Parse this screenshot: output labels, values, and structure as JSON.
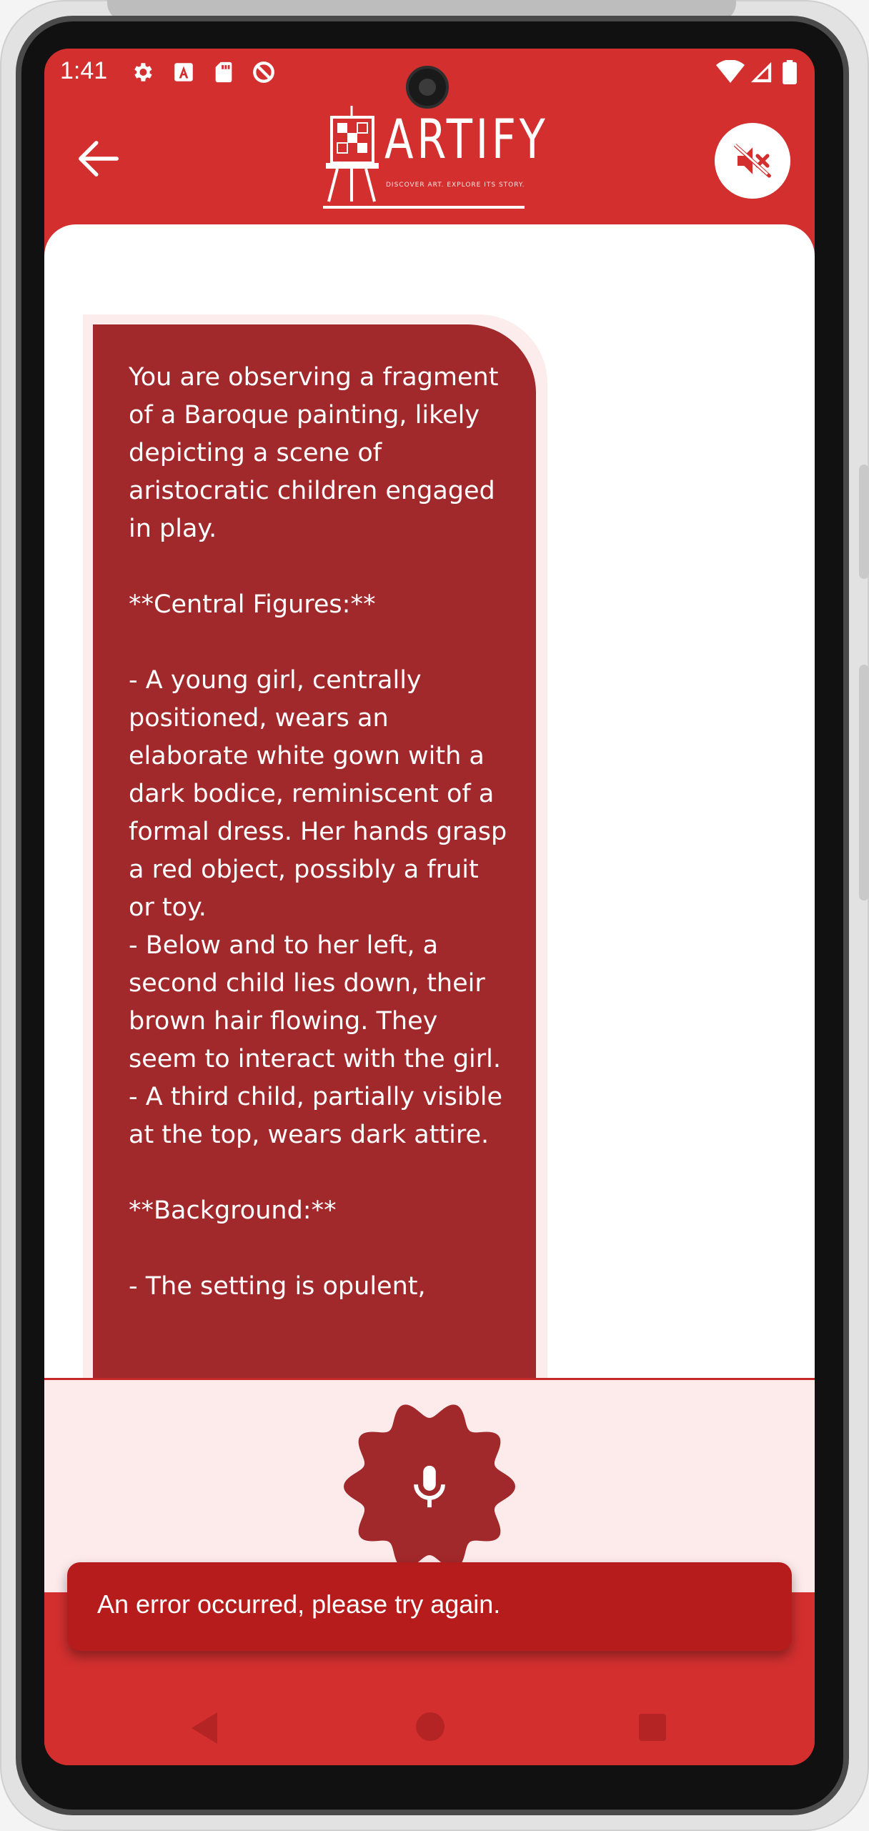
{
  "status_bar": {
    "time": "1:41",
    "icons": [
      "settings-icon",
      "text-a-icon",
      "sd-card-icon",
      "do-not-disturb-icon",
      "wifi-icon",
      "signal-icon",
      "battery-icon"
    ]
  },
  "app_bar": {
    "back_icon": "arrow-back-icon",
    "logo": {
      "name": "ARTIFY",
      "tagline": "DISCOVER ART. EXPLORE ITS STORY."
    },
    "mute_icon": "volume-off-icon"
  },
  "message": {
    "text": "You are observing a fragment of a Baroque painting, likely depicting a scene of aristocratic children engaged in play.\n\n**Central Figures:**\n\n- A young girl, centrally positioned, wears an elaborate white gown with a dark bodice, reminiscent of a formal dress. Her hands grasp a red object, possibly a fruit or toy.\n- Below and to her left, a second child lies down, their brown hair flowing. They seem to interact with the girl.\n- A third child, partially visible at the top, wears dark attire.\n\n**Background:**\n\n- The setting is opulent,"
  },
  "mic": {
    "icon": "microphone-icon"
  },
  "snackbar": {
    "text": "An error occurred, please try again."
  },
  "nav_bar": {
    "icons": [
      "nav-back-icon",
      "nav-home-icon",
      "nav-recents-icon"
    ]
  },
  "colors": {
    "primary": "#d32f2f",
    "bubble": "#a1282b",
    "snackbar": "#b71c1c",
    "panel": "#fdeaea"
  }
}
